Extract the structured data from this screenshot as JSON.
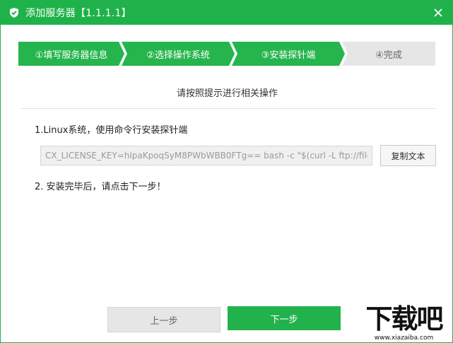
{
  "window": {
    "title": "添加服务器【1.1.1.1】"
  },
  "steps": [
    {
      "label": "①填写服务器信息",
      "state": "active"
    },
    {
      "label": "②选择操作系统",
      "state": "active"
    },
    {
      "label": "③安装探针端",
      "state": "active"
    },
    {
      "label": "④完成",
      "state": "inactive"
    }
  ],
  "subtitle": "请按照提示进行相关操作",
  "instruction1": "1.Linux系统，使用命令行安装探针端",
  "command": {
    "value": "CX_LICENSE_KEY=hlpaKpoqSyM8PWbWBB0FTg== bash -c \"$(curl -L ftp://file.cloudwise.com/toushibao/apm_install.sh)\""
  },
  "copy_button": "复制文本",
  "instruction2": "2. 安装完毕后，请点击下一步！",
  "buttons": {
    "prev": "上一步",
    "next": "下一步"
  },
  "watermark": {
    "text": "下载吧",
    "url": "www.xiazaiba.com"
  },
  "colors": {
    "brand_green": "#1fb24a",
    "inactive_step": "#e6e6e6"
  },
  "icons": {
    "app": "shield-check-icon",
    "close": "close-icon"
  }
}
